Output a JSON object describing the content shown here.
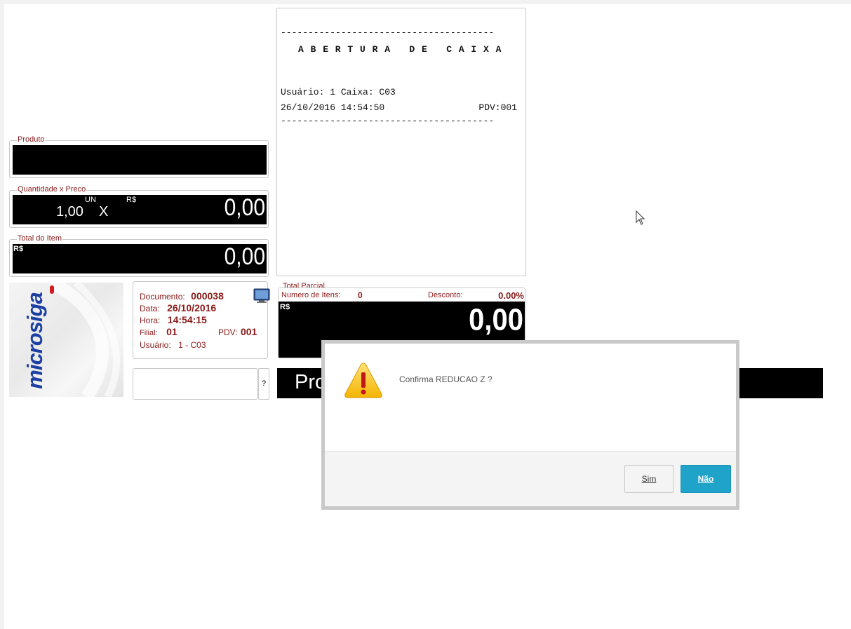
{
  "receipt": {
    "dash_line": "---------------------------------------",
    "title": "A B E R T U R A   D E   C A I X A",
    "user_line": "Usuário: 1 Caixa: C03",
    "datetime": "26/10/2016 14:54:50",
    "pdv": "PDV:001"
  },
  "produto": {
    "legend": "Produto",
    "value": ""
  },
  "quantidade": {
    "legend": "Quantidade x Preco",
    "qty": "1,00",
    "unit": "UN",
    "x": "X",
    "currency": "R$",
    "price": "0,00"
  },
  "total_item": {
    "legend": "Total do Item",
    "currency": "R$",
    "value": "0,00"
  },
  "logo": {
    "text": "microsiga"
  },
  "info": {
    "documento_label": "Documento:",
    "documento_value": "000038",
    "data_label": "Data:",
    "data_value": "26/10/2016",
    "hora_label": "Hora:",
    "hora_value": "14:54:15",
    "filial_label": "Filial:",
    "filial_value": "01",
    "pdv_label": "PDV:",
    "pdv_value": "001",
    "usuario_label": "Usuário:",
    "usuario_value": "1 - C03"
  },
  "total_parcial": {
    "legend": "Total Parcial",
    "itens_label": "Numero de Itens:",
    "itens_value": "0",
    "desconto_label": "Desconto:",
    "desconto_value": "0.00%",
    "currency": "R$",
    "value": "0,00"
  },
  "search": {
    "value": "",
    "help_label": "?"
  },
  "marquee": {
    "text": "Pro"
  },
  "dialog": {
    "message": "Confirma REDUCAO Z ?",
    "sim_label": "Sim",
    "nao_label": "Não"
  }
}
